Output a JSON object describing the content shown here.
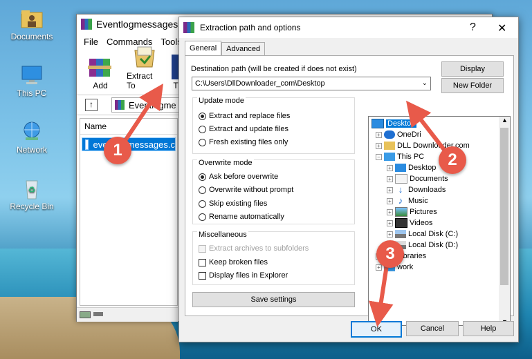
{
  "desktop": {
    "icons": [
      {
        "label": "Documents"
      },
      {
        "label": "This PC"
      },
      {
        "label": "Network"
      },
      {
        "label": "Recycle Bin"
      }
    ]
  },
  "archive_window": {
    "title": "Eventlogmessages.d",
    "menu": [
      "File",
      "Commands",
      "Tools"
    ],
    "toolbar": [
      {
        "label": "Add"
      },
      {
        "label": "Extract To"
      },
      {
        "label": "T"
      }
    ],
    "address": "Eventlogme",
    "column_name": "Name",
    "selected_file": "eventlogmessages.c"
  },
  "dialog": {
    "title": "Extraction path and options",
    "help_glyph": "?",
    "close_glyph": "✕",
    "tabs": [
      "General",
      "Advanced"
    ],
    "destination_label": "Destination path (will be created if does not exist)",
    "destination_value": "C:\\Users\\DllDownloader_com\\Desktop",
    "display_button": "Display",
    "new_folder_button": "New Folder",
    "update_mode": {
      "title": "Update mode",
      "options": [
        "Extract and replace files",
        "Extract and update files",
        "Fresh existing files only"
      ]
    },
    "overwrite_mode": {
      "title": "Overwrite mode",
      "options": [
        "Ask before overwrite",
        "Overwrite without prompt",
        "Skip existing files",
        "Rename automatically"
      ]
    },
    "misc": {
      "title": "Miscellaneous",
      "options": [
        "Extract archives to subfolders",
        "Keep broken files",
        "Display files in Explorer"
      ]
    },
    "save_settings_button": "Save settings",
    "tree": {
      "items": [
        {
          "label": "Desktop"
        },
        {
          "label": "OneDri"
        },
        {
          "label": "DLL Downloader.com"
        },
        {
          "label": "This PC"
        },
        {
          "label": "Desktop"
        },
        {
          "label": "Documents"
        },
        {
          "label": "Downloads"
        },
        {
          "label": "Music"
        },
        {
          "label": "Pictures"
        },
        {
          "label": "Videos"
        },
        {
          "label": "Local Disk (C:)"
        },
        {
          "label": "Local Disk (D:)"
        },
        {
          "label": "Libraries"
        },
        {
          "label": "work"
        }
      ]
    },
    "ok_button": "OK",
    "cancel_button": "Cancel",
    "help_button": "Help"
  },
  "markers": [
    "1",
    "2",
    "3"
  ],
  "colors": {
    "selection": "#0078d7",
    "marker": "#e85a4a"
  }
}
